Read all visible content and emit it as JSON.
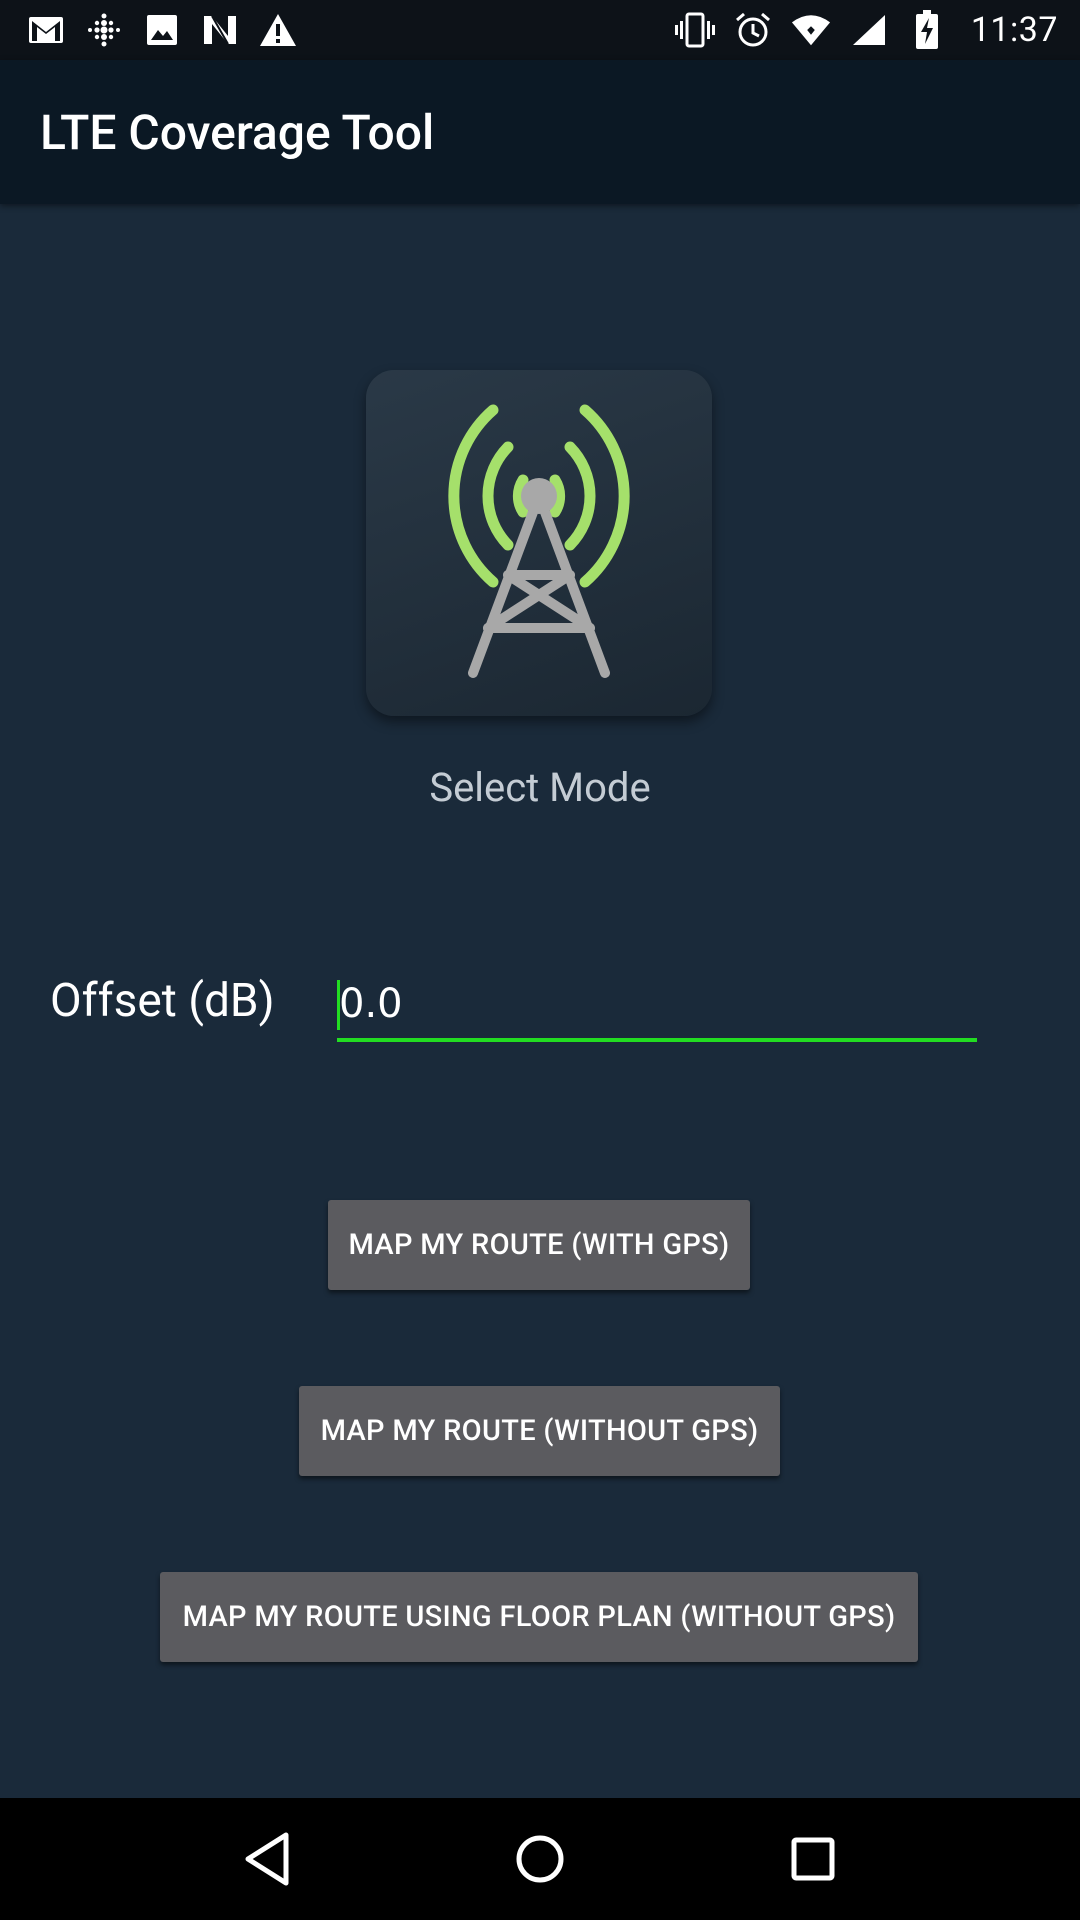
{
  "status_bar": {
    "time": "11:37",
    "left_icons": [
      "gmail-icon",
      "fitbit-icon",
      "image-icon",
      "n-app-icon",
      "warning-icon"
    ],
    "right_icons": [
      "vibrate-icon",
      "alarm-icon",
      "wifi-icon",
      "cell-signal-icon",
      "battery-charging-icon"
    ]
  },
  "app_bar": {
    "title": "LTE Coverage Tool"
  },
  "main": {
    "logo_icon": "cell-tower-icon",
    "select_mode_label": "Select Mode",
    "offset": {
      "label": "Offset (dB)",
      "value": "0.0"
    },
    "buttons": [
      {
        "label": "MAP MY ROUTE (WITH GPS)"
      },
      {
        "label": "MAP MY ROUTE (WITHOUT GPS)"
      },
      {
        "label": "MAP MY ROUTE USING FLOOR PLAN (WITHOUT GPS)"
      }
    ]
  },
  "nav_bar": {
    "icons": [
      "back-icon",
      "home-icon",
      "recents-icon"
    ]
  },
  "colors": {
    "background": "#1a2a3a",
    "app_bar": "#0b1824",
    "accent_green": "#22dd22",
    "tower_waves": "#a5e06b",
    "tower_body": "#a8a8a8",
    "button": "#5b5b5f"
  }
}
